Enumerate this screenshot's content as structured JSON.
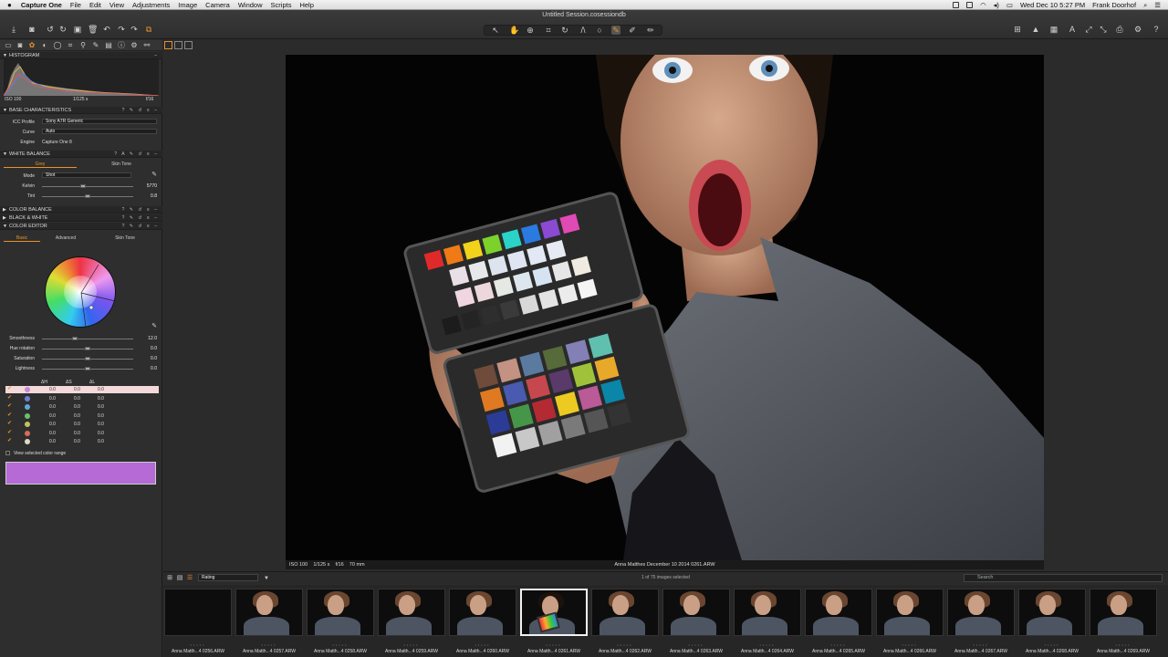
{
  "menubar": {
    "apple": "",
    "items": [
      "Capture One",
      "File",
      "Edit",
      "View",
      "Adjustments",
      "Image",
      "Camera",
      "Window",
      "Scripts",
      "Help"
    ],
    "datetime": "Wed Dec 10  5:27 PM",
    "user": "Frank Doorhof"
  },
  "window": {
    "title": "Untitled Session.cosessiondb"
  },
  "panel": {
    "histogram": {
      "title": "HISTOGRAM",
      "iso": "ISO 100",
      "shutter": "1/125 s",
      "aperture": "f/16"
    },
    "base": {
      "title": "BASE CHARACTERISTICS",
      "icc_label": "ICC Profile",
      "icc_value": "Sony A7R Generic",
      "curve_label": "Curve",
      "curve_value": "Auto",
      "engine_label": "Engine",
      "engine_value": "Capture One 8"
    },
    "wb": {
      "title": "WHITE BALANCE",
      "tab_grey": "Grey",
      "tab_skin": "Skin Tone",
      "mode_label": "Mode",
      "mode_value": "Shot",
      "kelvin_label": "Kelvin",
      "kelvin_value": "5770",
      "tint_label": "Tint",
      "tint_value": "0.8",
      "kelvin_pos": 0.45,
      "tint_pos": 0.5
    },
    "color_balance": {
      "title": "COLOR BALANCE"
    },
    "bw": {
      "title": "BLACK & WHITE"
    },
    "color_editor": {
      "title": "COLOR EDITOR",
      "tabs": [
        "Basic",
        "Advanced",
        "Skin Tone"
      ],
      "sliders": [
        {
          "label": "Smoothness",
          "value": "12.0",
          "pos": 0.36
        },
        {
          "label": "Hue rotation",
          "value": "0.0",
          "pos": 0.5
        },
        {
          "label": "Saturation",
          "value": "0.0",
          "pos": 0.5
        },
        {
          "label": "Lightness",
          "value": "0.0",
          "pos": 0.5
        }
      ],
      "headers": [
        "ΔH",
        "ΔS",
        "ΔL"
      ],
      "rows": [
        {
          "color": "#c889d8",
          "h": "0.0",
          "s": "0.0",
          "l": "0.0"
        },
        {
          "color": "#6a7fd8",
          "h": "0.0",
          "s": "0.0",
          "l": "0.0"
        },
        {
          "color": "#5fa8d8",
          "h": "0.0",
          "s": "0.0",
          "l": "0.0"
        },
        {
          "color": "#6cc06a",
          "h": "0.0",
          "s": "0.0",
          "l": "0.0"
        },
        {
          "color": "#c2c25a",
          "h": "0.0",
          "s": "0.0",
          "l": "0.0"
        },
        {
          "color": "#d86b5a",
          "h": "0.0",
          "s": "0.0",
          "l": "0.0"
        },
        {
          "color": "#e0d8c8",
          "h": "0.0",
          "s": "0.0",
          "l": "0.0"
        }
      ],
      "view_range": "View selected color range",
      "swatch_color": "#b56ad6"
    }
  },
  "viewer": {
    "info_left": [
      "ISO 100",
      "1/125 s",
      "f/16",
      "70 mm"
    ],
    "info_center": "Anna Matthes December 10 2014 0261.ARW"
  },
  "filmstrip": {
    "sort": "Rating",
    "count": "1 of 75 images selected",
    "search_placeholder": "Search",
    "thumbs": [
      "Anna Matth...4 0256.ARW",
      "Anna Matth...4 0257.ARW",
      "Anna Matth...4 0258.ARW",
      "Anna Matth...4 0259.ARW",
      "Anna Matth...4 0260.ARW",
      "Anna Matth...4 0261.ARW",
      "Anna Matth...4 0262.ARW",
      "Anna Matth...4 0263.ARW",
      "Anna Matth...4 0264.ARW",
      "Anna Matth...4 0265.ARW",
      "Anna Matth...4 0266.ARW",
      "Anna Matth...4 0267.ARW",
      "Anna Matth...4 0268.ARW",
      "Anna Matth...4 0269.ARW"
    ],
    "selected_index": 5
  }
}
